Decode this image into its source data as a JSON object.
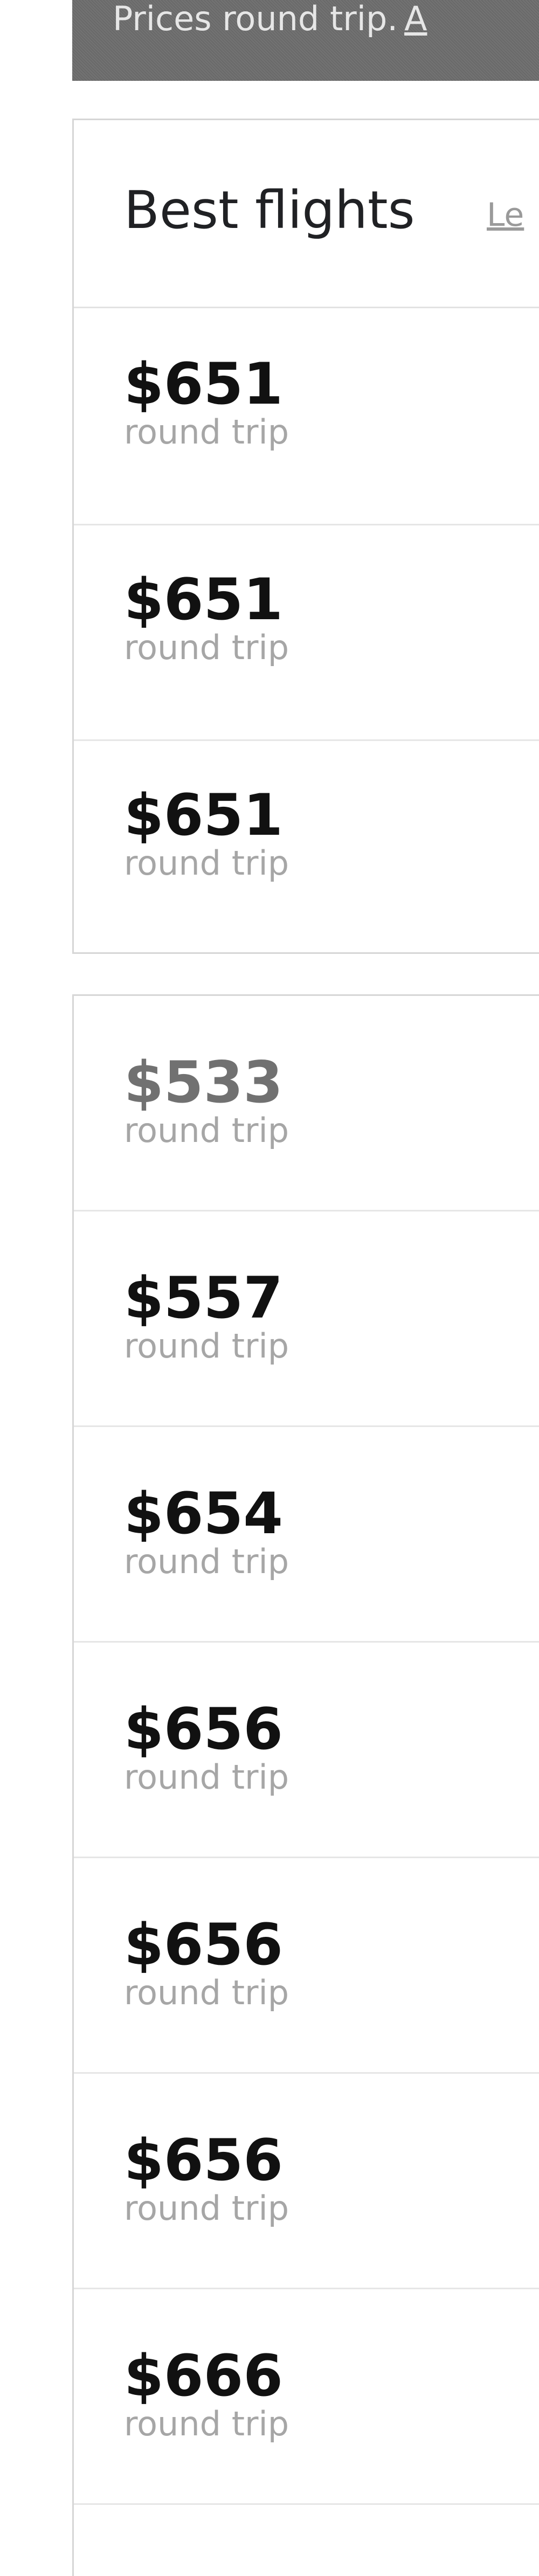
{
  "banner": {
    "text": "Prices round trip.",
    "link_text": "A"
  },
  "best_flights": {
    "title": "Best flights",
    "link_text": "Le",
    "rows": [
      {
        "price": "$651",
        "label": "round trip"
      },
      {
        "price": "$651",
        "label": "round trip"
      },
      {
        "price": "$651",
        "label": "round trip"
      }
    ]
  },
  "other_flights": {
    "rows": [
      {
        "price": "$533",
        "label": "round trip"
      },
      {
        "price": "$557",
        "label": "round trip"
      },
      {
        "price": "$654",
        "label": "round trip"
      },
      {
        "price": "$656",
        "label": "round trip"
      },
      {
        "price": "$656",
        "label": "round trip"
      },
      {
        "price": "$656",
        "label": "round trip"
      },
      {
        "price": "$666",
        "label": "round trip"
      }
    ]
  }
}
